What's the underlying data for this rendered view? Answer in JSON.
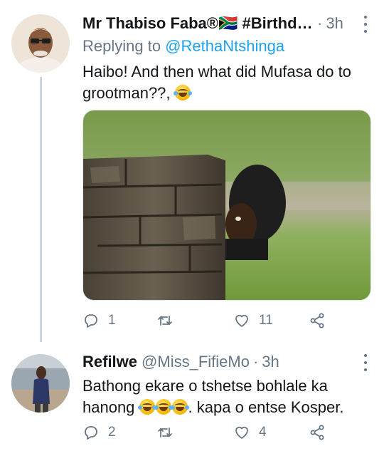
{
  "tweets": [
    {
      "name": "Mr Thabiso Faba®🇿🇦 #Birthday...",
      "time": "3h",
      "replying_label": "Replying to",
      "replying_to": "@RethaNtshinga",
      "text": "Haibo! And then what did Mufasa do to grootman??,",
      "emoji": "face-with-tears-of-joy",
      "has_media": true,
      "replies": "1",
      "retweets": "",
      "likes": "11"
    },
    {
      "name": "Refilwe",
      "handle": "@Miss_FifieMo",
      "time": "3h",
      "text_part1": "Bathong ekare o tshetse bohlale ka hanong",
      "emoji": "face-with-tears-of-joy",
      "emoji_count": 3,
      "text_part2": ". kapa o entse Kosper.",
      "replies": "2",
      "retweets": "",
      "likes": "4"
    }
  ],
  "colors": {
    "link": "#1da1f2",
    "secondary": "#657786",
    "primary_text": "#14171a",
    "thread_line": "#ccd6dd"
  },
  "icons": [
    "reply-icon",
    "retweet-icon",
    "like-icon",
    "share-icon",
    "more-icon"
  ]
}
